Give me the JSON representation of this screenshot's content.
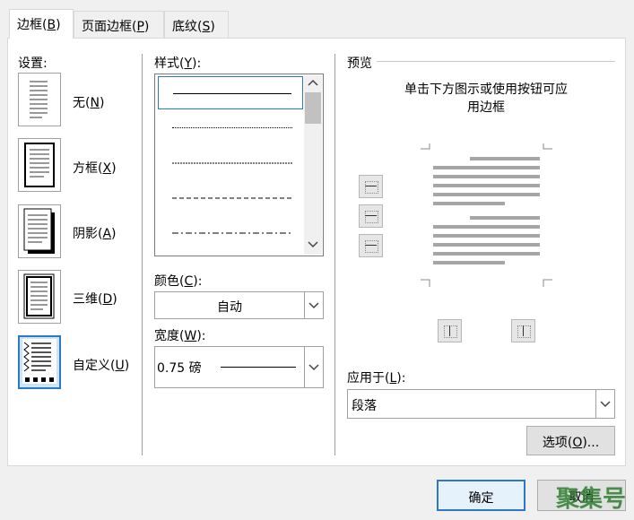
{
  "tabs": [
    {
      "label": "边框(",
      "key": "B",
      "tail": ")"
    },
    {
      "label": "页面边框(",
      "key": "P",
      "tail": ")"
    },
    {
      "label": "底纹(",
      "key": "S",
      "tail": ")"
    }
  ],
  "settings": {
    "heading": "设置:",
    "items": [
      {
        "label": "无(",
        "key": "N",
        "tail": ")"
      },
      {
        "label": "方框(",
        "key": "X",
        "tail": ")"
      },
      {
        "label": "阴影(",
        "key": "A",
        "tail": ")"
      },
      {
        "label": "三维(",
        "key": "D",
        "tail": ")"
      },
      {
        "label": "自定义(",
        "key": "U",
        "tail": ")"
      }
    ],
    "selected": "自定义"
  },
  "style": {
    "heading": "样式(",
    "key": "Y",
    "tail": "):"
  },
  "color": {
    "heading": "颜色(",
    "key": "C",
    "tail": "):",
    "value": "自动"
  },
  "width": {
    "heading": "宽度(",
    "key": "W",
    "tail": "):",
    "value": "0.75 磅"
  },
  "preview": {
    "heading": "预览",
    "hint_line1": "单击下方图示或使用按钮可应",
    "hint_line2": "用边框"
  },
  "apply_to": {
    "heading": "应用于(",
    "key": "L",
    "tail": "):",
    "value": "段落"
  },
  "buttons": {
    "options": "选项(",
    "options_key": "O",
    "options_tail": ")...",
    "ok": "确定",
    "cancel": "取消"
  },
  "watermark": "聚集号",
  "colors": {
    "accent": "#2b78c4",
    "selected_bg": "#cde6f7"
  }
}
